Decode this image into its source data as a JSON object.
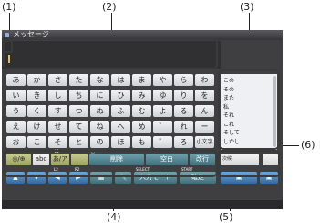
{
  "callouts": {
    "c1": "(1)",
    "c2": "(2)",
    "c3": "(3)",
    "c4": "(4)",
    "c5": "(5)",
    "c6": "(6)"
  },
  "window": {
    "title": "メッセージ"
  },
  "keyboard": {
    "rows": [
      [
        "あ",
        "か",
        "さ",
        "た",
        "な",
        "は",
        "ま",
        "や",
        "ら",
        "わ"
      ],
      [
        "い",
        "き",
        "し",
        "ち",
        "に",
        "ひ",
        "み",
        "ゆ",
        "り",
        "を"
      ],
      [
        "う",
        "く",
        "す",
        "つ",
        "ぬ",
        "ふ",
        "む",
        "よ",
        "る",
        "ん"
      ],
      [
        "え",
        "け",
        "せ",
        "て",
        "ね",
        "へ",
        "め",
        "",
        "れ",
        "ー"
      ],
      [
        "お",
        "こ",
        "そ",
        "と",
        "の",
        "ほ",
        "も",
        "゜",
        "ろ",
        "小文字"
      ]
    ],
    "extra_key": "゛"
  },
  "candidates": [
    "この",
    "その",
    "また",
    "私",
    "それ",
    "これ",
    "そして",
    "しかし"
  ],
  "function_row": {
    "mode1": "◎/⊕",
    "mode2": "abc",
    "mode3": "あ/ア",
    "delete": "削除",
    "space": "空白",
    "newline": "改行",
    "field": "次候"
  },
  "nav_row": {
    "select": "SELECT",
    "input_mode": "入力モード",
    "start": "START",
    "confirm": "確定"
  },
  "badges": {
    "l1": "L1",
    "l2": "L2",
    "r1": "R1",
    "r2": "R2",
    "sq": "□"
  }
}
